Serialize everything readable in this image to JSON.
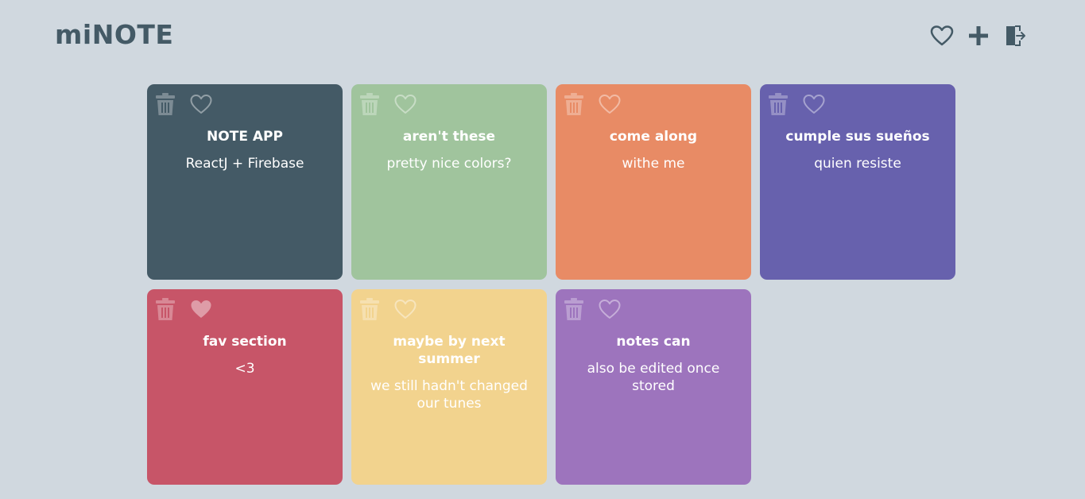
{
  "app": {
    "logo": "miNOTE"
  },
  "header": {
    "actions": [
      {
        "name": "favorites",
        "icon": "heart-outline-icon"
      },
      {
        "name": "add-note",
        "icon": "plus-icon"
      },
      {
        "name": "logout",
        "icon": "door-exit-icon"
      }
    ],
    "icon_color": "#445a66"
  },
  "notes": [
    {
      "title": "NOTE APP",
      "body": "ReactJ + Firebase",
      "color": "#445a66",
      "favorite": false
    },
    {
      "title": "aren't these",
      "body": "pretty nice colors?",
      "color": "#a0c49d",
      "favorite": false
    },
    {
      "title": "come along",
      "body": "withe me",
      "color": "#e88b65",
      "favorite": false
    },
    {
      "title": "cumple sus sueños",
      "body": "quien resiste",
      "color": "#6761ad",
      "favorite": false
    },
    {
      "title": "fav section",
      "body": "<3",
      "color": "#c75568",
      "favorite": true
    },
    {
      "title": "maybe by next summer",
      "body": "we still hadn't changed our tunes",
      "color": "#f2d38e",
      "favorite": false
    },
    {
      "title": "notes can",
      "body": "also be edited once stored",
      "color": "#9d74bd",
      "favorite": false
    }
  ]
}
